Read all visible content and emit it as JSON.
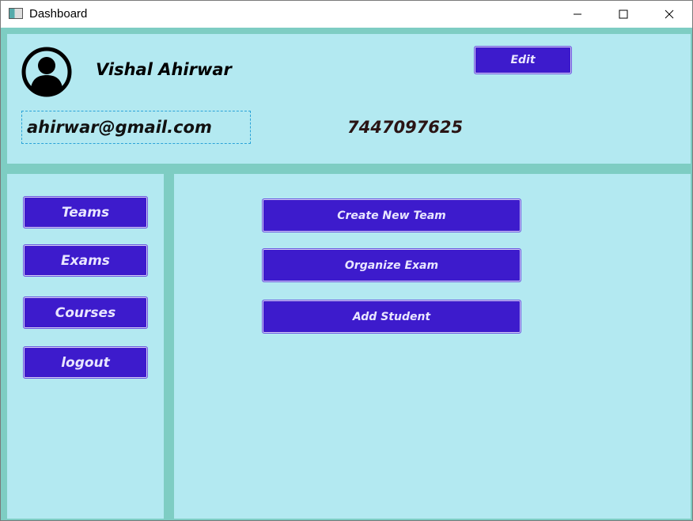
{
  "window": {
    "title": "Dashboard"
  },
  "profile": {
    "name": "Vishal Ahirwar",
    "email": "ahirwar@gmail.com",
    "phone": "7447097625",
    "edit_label": "Edit",
    "avatar_icon": "user-avatar-icon"
  },
  "sidebar": {
    "items": [
      {
        "label": "Teams"
      },
      {
        "label": "Exams"
      },
      {
        "label": "Courses"
      },
      {
        "label": "logout"
      }
    ]
  },
  "main": {
    "actions": [
      {
        "label": "Create New Team"
      },
      {
        "label": "Organize Exam"
      },
      {
        "label": "Add Student"
      }
    ]
  },
  "colors": {
    "background_frame": "#7ecdc3",
    "panel": "#b3e9f1",
    "button": "#3d1bcc",
    "button_text": "#e9e6ff",
    "email_border": "#2aa3d8"
  }
}
